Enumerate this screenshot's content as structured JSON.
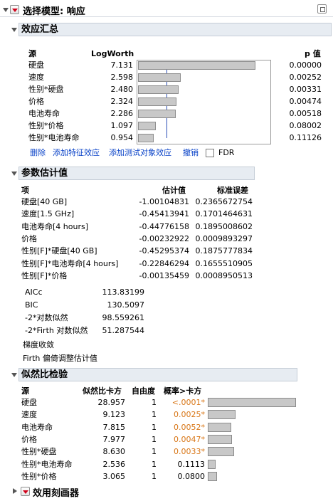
{
  "title": "选择模型: 响应",
  "effect_summary": {
    "title": "效应汇总",
    "headers": {
      "source": "源",
      "logworth": "LogWorth",
      "pvalue": "p 值"
    },
    "rows": [
      {
        "source": "硬盘",
        "logworth": "7.131",
        "pvalue": "0.00000",
        "value": 7.131
      },
      {
        "source": "速度",
        "logworth": "2.598",
        "pvalue": "0.00252",
        "value": 2.598
      },
      {
        "source": "性别*硬盘",
        "logworth": "2.480",
        "pvalue": "0.00331",
        "value": 2.48
      },
      {
        "source": "价格",
        "logworth": "2.324",
        "pvalue": "0.00474",
        "value": 2.324
      },
      {
        "source": "电池寿命",
        "logworth": "2.286",
        "pvalue": "0.00518",
        "value": 2.286
      },
      {
        "source": "性别*价格",
        "logworth": "1.097",
        "pvalue": "0.08002",
        "value": 1.097
      },
      {
        "source": "性别*电池寿命",
        "logworth": "0.954",
        "pvalue": "0.11126",
        "value": 0.954
      }
    ],
    "actions": [
      "删除",
      "添加特征效应",
      "添加测试对象效应",
      "撤销"
    ],
    "fdr_label": "FDR"
  },
  "param_estimates": {
    "title": "参数估计值",
    "headers": {
      "term": "项",
      "estimate": "估计值",
      "stderr": "标准误差"
    },
    "rows": [
      {
        "term": "硬盘[40 GB]",
        "estimate": "-1.00104831",
        "stderr": "0.2365672754"
      },
      {
        "term": "速度[1.5 GHz]",
        "estimate": "-0.45413941",
        "stderr": "0.1701464631"
      },
      {
        "term": "电池寿命[4 hours]",
        "estimate": "-0.44776158",
        "stderr": "0.1895008602"
      },
      {
        "term": "价格",
        "estimate": "-0.00232922",
        "stderr": "0.0009893297"
      },
      {
        "term": "性别[F]*硬盘[40 GB]",
        "estimate": "-0.45295374",
        "stderr": "0.1875777834"
      },
      {
        "term": "性别[F]*电池寿命[4 hours]",
        "estimate": "-0.22846294",
        "stderr": "0.1655510905"
      },
      {
        "term": "性别[F]*价格",
        "estimate": "-0.00135459",
        "stderr": "0.0008950513"
      }
    ],
    "fit_stats": [
      {
        "label": "AICc",
        "value": "113.83199"
      },
      {
        "label": "BIC",
        "value": "130.5097"
      },
      {
        "label": "-2*对数似然",
        "value": "98.559261"
      },
      {
        "label": "-2*Firth 对数似然",
        "value": "51.287544"
      }
    ],
    "notes": [
      "梯度收敛",
      "Firth 偏倚调整估计值"
    ]
  },
  "lr_tests": {
    "title": "似然比检验",
    "headers": {
      "source": "源",
      "chisq": "似然比卡方",
      "df": "自由度",
      "prob": "概率>卡方"
    },
    "rows": [
      {
        "source": "硬盘",
        "chisq": "28.957",
        "df": "1",
        "prob": "<.0001*",
        "sig": true,
        "value": 28.957
      },
      {
        "source": "速度",
        "chisq": "9.123",
        "df": "1",
        "prob": "0.0025*",
        "sig": true,
        "value": 9.123
      },
      {
        "source": "电池寿命",
        "chisq": "7.815",
        "df": "1",
        "prob": "0.0052*",
        "sig": true,
        "value": 7.815
      },
      {
        "source": "价格",
        "chisq": "7.977",
        "df": "1",
        "prob": "0.0047*",
        "sig": true,
        "value": 7.977
      },
      {
        "source": "性别*硬盘",
        "chisq": "8.630",
        "df": "1",
        "prob": "0.0033*",
        "sig": true,
        "value": 8.63
      },
      {
        "source": "性别*电池寿命",
        "chisq": "2.536",
        "df": "1",
        "prob": "0.1113",
        "sig": false,
        "value": 2.536
      },
      {
        "source": "性别*价格",
        "chisq": "3.065",
        "df": "1",
        "prob": "0.0800",
        "sig": false,
        "value": 3.065
      }
    ]
  },
  "utility_profiler": {
    "title": "效用刻画器"
  },
  "colors": {
    "significant": "#d9781a",
    "link": "#0a43c8",
    "header_bg": "#e7ecf2"
  }
}
